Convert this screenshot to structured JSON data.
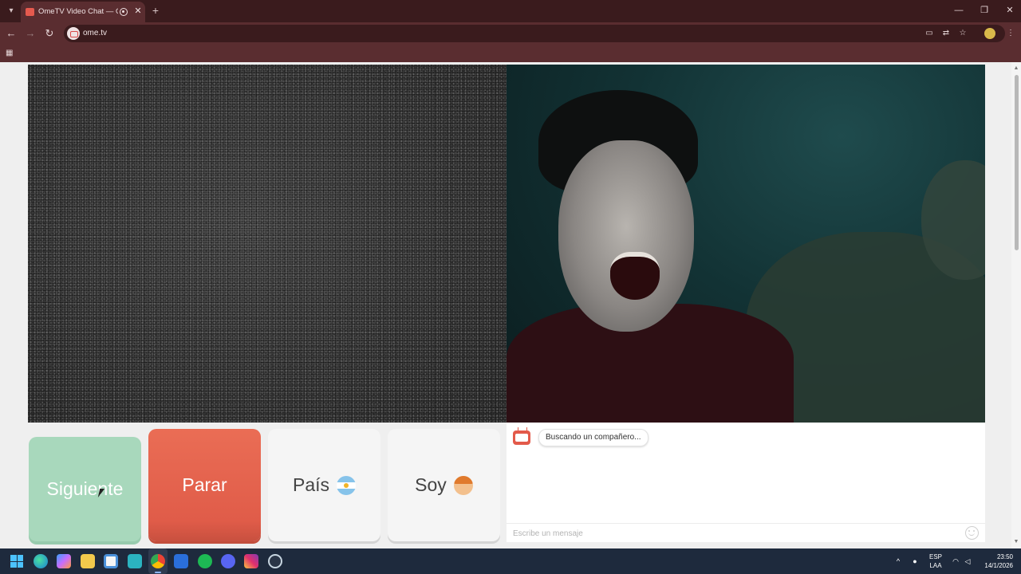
{
  "browser": {
    "tab_title": "OmeTV Video Chat — Ome",
    "url": "ome.tv",
    "window_controls": {
      "minimize": "—",
      "restore": "❐",
      "close": "✕"
    },
    "tab_close": "✕",
    "new_tab": "+"
  },
  "page": {
    "buttons": {
      "next": "Siguiente",
      "stop": "Parar",
      "country": "País",
      "gender": "Soy"
    },
    "chat": {
      "status_message": "Buscando un compañero...",
      "input_placeholder": "Escribe un mensaje"
    }
  },
  "taskbar": {
    "language_line1": "ESP",
    "language_line2": "LAA",
    "time": "23:50",
    "date": "14/1/2026",
    "apps": [
      "start",
      "edge",
      "copilot",
      "file-explorer",
      "store",
      "shield-app",
      "chrome",
      "mail",
      "spotify",
      "discord",
      "instagram",
      "steam"
    ]
  },
  "colors": {
    "next_button": "#a8d8bc",
    "stop_button": "#e8654f",
    "browser_frame": "#5a2d30",
    "taskbar": "#1e2a3d"
  }
}
